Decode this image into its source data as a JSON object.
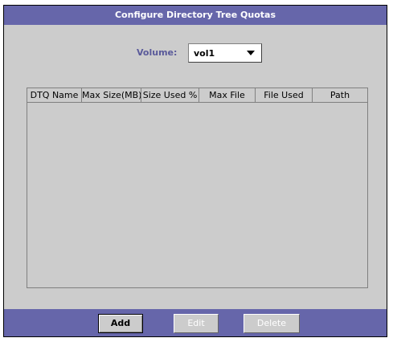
{
  "window": {
    "title": "Configure Directory Tree Quotas"
  },
  "volume": {
    "label": "Volume:",
    "selected": "vol1"
  },
  "table": {
    "columns": [
      "DTQ Name",
      "Max Size(MB)",
      "Size Used %",
      "Max File",
      "File Used",
      "Path"
    ],
    "rows": []
  },
  "buttons": {
    "add": "Add",
    "edit": "Edit",
    "delete": "Delete"
  },
  "colors": {
    "bar": "#6666aa",
    "panel": "#cccccc",
    "label": "#5a5a9a"
  },
  "icons": {
    "dropdown": "chevron-down-icon"
  }
}
